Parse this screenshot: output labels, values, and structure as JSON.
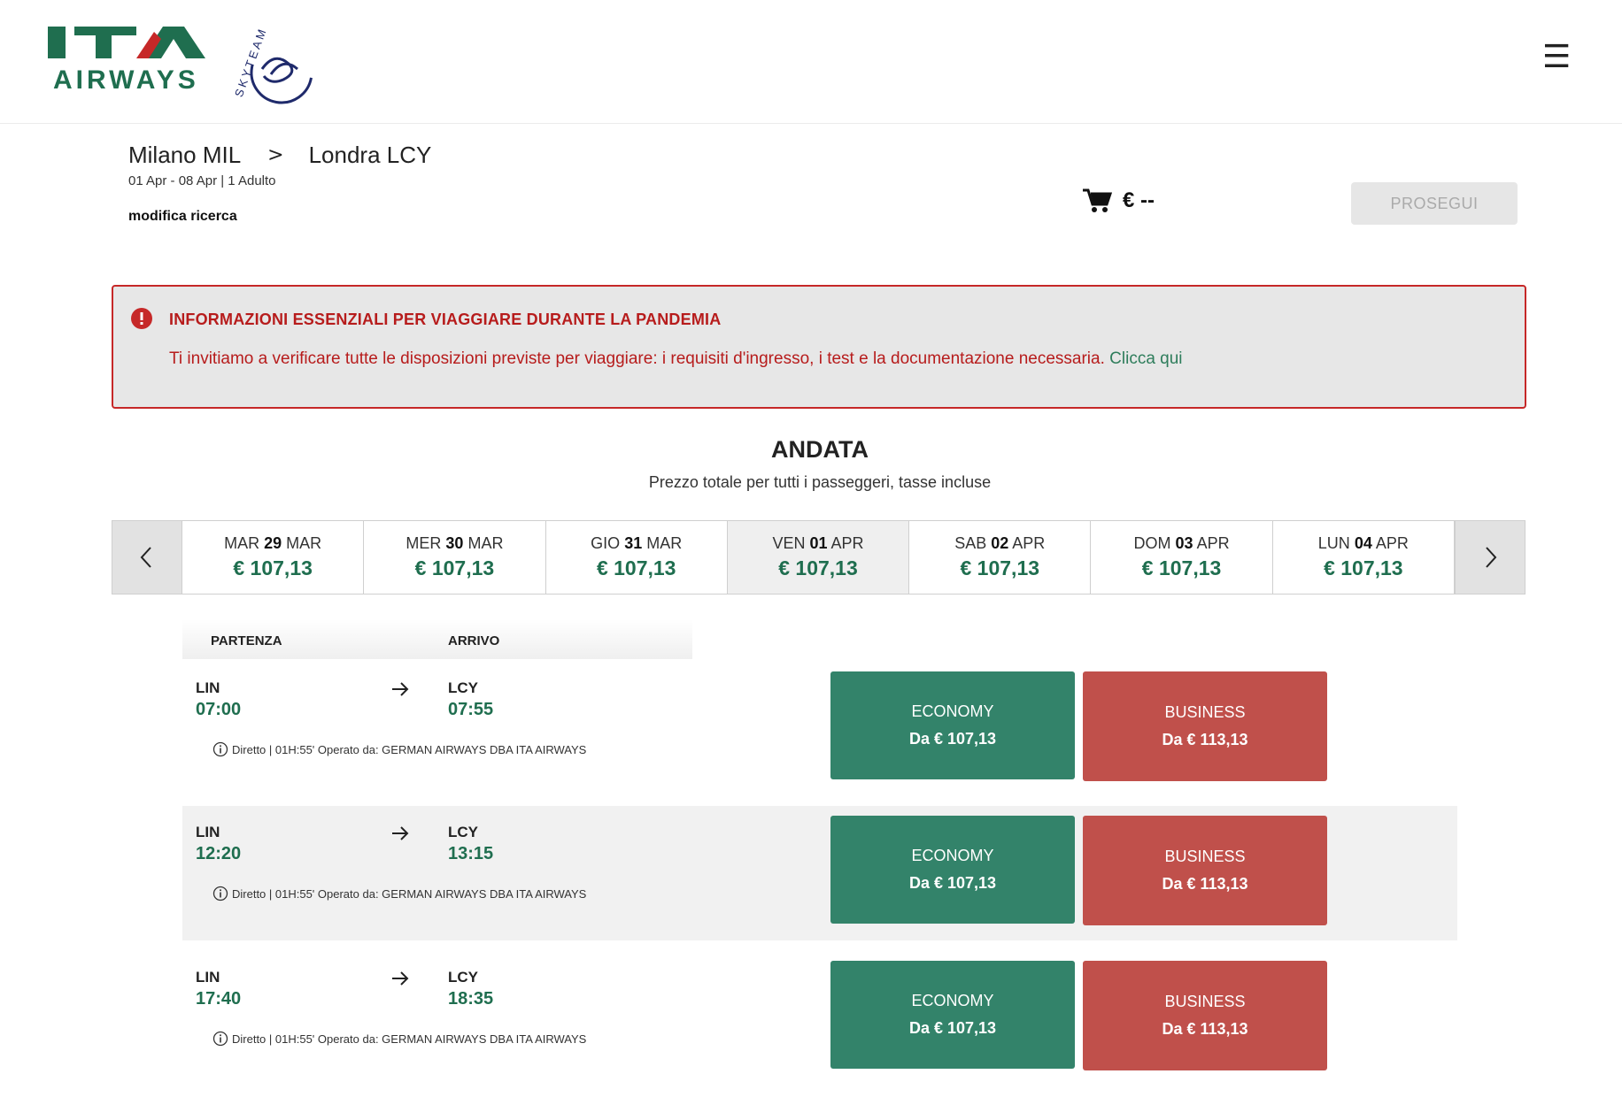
{
  "brand": {
    "name_top": "ITA",
    "name_bottom": "AIRWAYS",
    "alliance": "SKYTEAM",
    "green": "#1f6e4f",
    "red": "#c62828"
  },
  "header": {
    "menu_icon": "hamburger-icon"
  },
  "search": {
    "origin": "Milano MIL",
    "destination": "Londra LCY",
    "details": "01 Apr - 08 Apr | 1 Adulto",
    "modify_label": "modifica ricerca"
  },
  "cart": {
    "icon": "cart-icon",
    "price": "€ --"
  },
  "proceed_label": "PROSEGUI",
  "alert": {
    "icon": "exclamation-icon",
    "title": "INFORMAZIONI ESSENZIALI PER VIAGGIARE DURANTE LA PANDEMIA",
    "text": "Ti invitiamo a verificare tutte le disposizioni previste per viaggiare: i requisiti d'ingresso, i test e la documentazione necessaria.",
    "link": "Clicca qui"
  },
  "section": {
    "title": "ANDATA",
    "subtitle": "Prezzo totale per tutti i passeggeri, tasse incluse"
  },
  "dates": [
    {
      "dow": "MAR",
      "day": "29",
      "month": "MAR",
      "price": "€ 107,13"
    },
    {
      "dow": "MER",
      "day": "30",
      "month": "MAR",
      "price": "€ 107,13"
    },
    {
      "dow": "GIO",
      "day": "31",
      "month": "MAR",
      "price": "€ 107,13"
    },
    {
      "dow": "VEN",
      "day": "01",
      "month": "APR",
      "price": "€ 107,13"
    },
    {
      "dow": "SAB",
      "day": "02",
      "month": "APR",
      "price": "€ 107,13"
    },
    {
      "dow": "DOM",
      "day": "03",
      "month": "APR",
      "price": "€ 107,13"
    },
    {
      "dow": "LUN",
      "day": "04",
      "month": "APR",
      "price": "€ 107,13"
    }
  ],
  "columns": {
    "departure": "PARTENZA",
    "arrival": "ARRIVO"
  },
  "flights": [
    {
      "from": "LIN",
      "dep": "07:00",
      "to": "LCY",
      "arr": "07:55",
      "info": "Diretto | 01H:55' Operato da: GERMAN AIRWAYS DBA ITA AIRWAYS",
      "economy": {
        "label": "ECONOMY",
        "price": "Da € 107,13"
      },
      "business": {
        "label": "BUSINESS",
        "price": "Da € 113,13"
      }
    },
    {
      "from": "LIN",
      "dep": "12:20",
      "to": "LCY",
      "arr": "13:15",
      "info": "Diretto | 01H:55' Operato da: GERMAN AIRWAYS DBA ITA AIRWAYS",
      "economy": {
        "label": "ECONOMY",
        "price": "Da € 107,13"
      },
      "business": {
        "label": "BUSINESS",
        "price": "Da € 113,13"
      }
    },
    {
      "from": "LIN",
      "dep": "17:40",
      "to": "LCY",
      "arr": "18:35",
      "info": "Diretto | 01H:55' Operato da: GERMAN AIRWAYS DBA ITA AIRWAYS",
      "economy": {
        "label": "ECONOMY",
        "price": "Da € 107,13"
      },
      "business": {
        "label": "BUSINESS",
        "price": "Da € 113,13"
      }
    }
  ]
}
